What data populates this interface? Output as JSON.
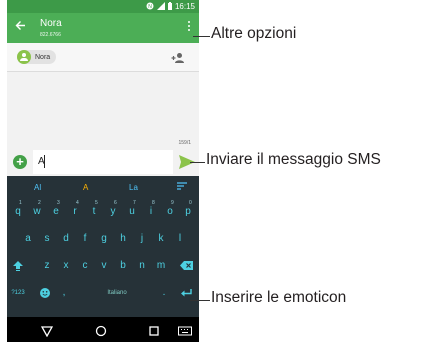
{
  "status_bar": {
    "time": "16:15",
    "icons": [
      "nfc-icon",
      "signal-icon",
      "battery-icon"
    ]
  },
  "app_bar": {
    "contact_name": "Nora",
    "contact_number": "822.6766"
  },
  "recipient_chip": {
    "label": "Nora"
  },
  "composer": {
    "counter": "159/1",
    "text": "A"
  },
  "keyboard": {
    "suggestions": [
      "Al",
      "A",
      "La"
    ],
    "row1": [
      {
        "key": "q",
        "num": "1"
      },
      {
        "key": "w",
        "num": "2"
      },
      {
        "key": "e",
        "num": "3"
      },
      {
        "key": "r",
        "num": "4"
      },
      {
        "key": "t",
        "num": "5"
      },
      {
        "key": "y",
        "num": "6"
      },
      {
        "key": "u",
        "num": "7"
      },
      {
        "key": "i",
        "num": "8"
      },
      {
        "key": "o",
        "num": "9"
      },
      {
        "key": "p",
        "num": "0"
      }
    ],
    "row2": [
      "a",
      "s",
      "d",
      "f",
      "g",
      "h",
      "j",
      "k",
      "l"
    ],
    "row3": [
      "z",
      "x",
      "c",
      "v",
      "b",
      "n",
      "m"
    ],
    "row4": {
      "symbols": "?123",
      "comma": ",",
      "space": "Italiano",
      "period": "."
    }
  },
  "callouts": {
    "more_options": "Altre opzioni",
    "send_sms": "Inviare il messaggio SMS",
    "insert_emoticon": "Inserire le emoticon"
  },
  "colors": {
    "app_bar": "#4cae56",
    "status_bar": "#3d9a48",
    "keyboard_bg": "#263238",
    "key_text": "#4dd0e1",
    "send": "#8bc34a"
  }
}
